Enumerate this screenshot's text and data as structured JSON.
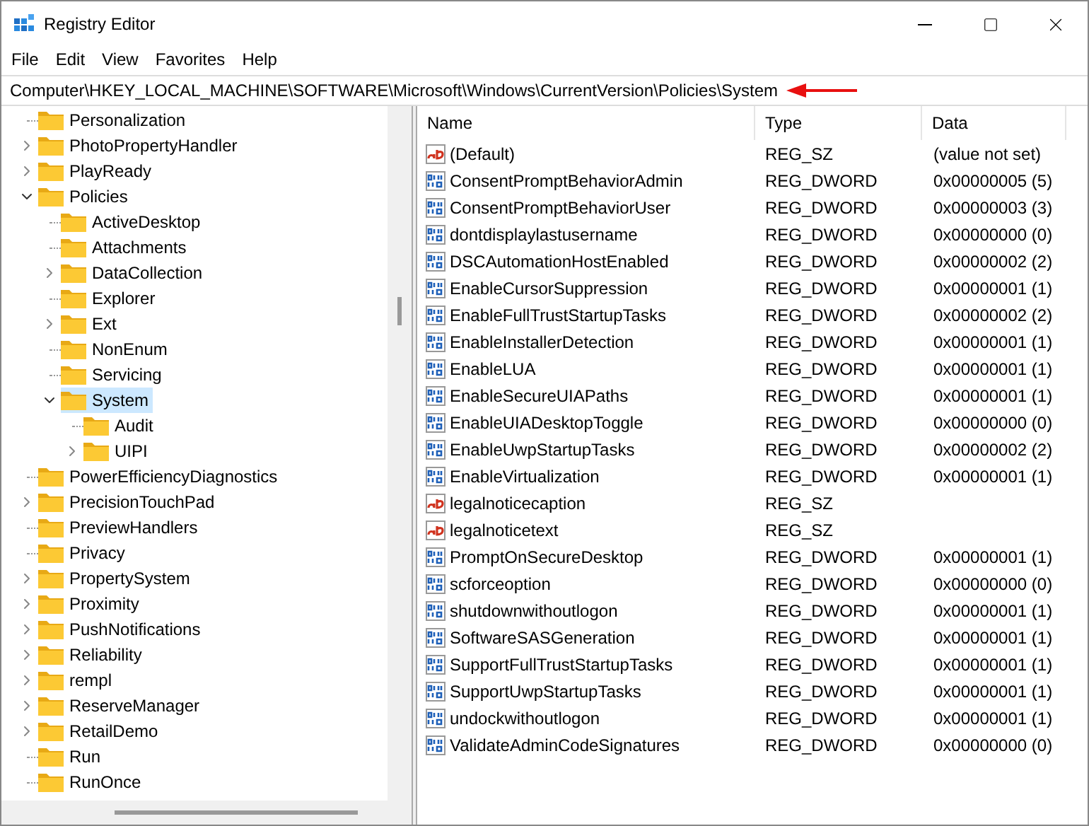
{
  "window": {
    "title": "Registry Editor"
  },
  "menu": [
    "File",
    "Edit",
    "View",
    "Favorites",
    "Help"
  ],
  "address": "Computer\\HKEY_LOCAL_MACHINE\\SOFTWARE\\Microsoft\\Windows\\CurrentVersion\\Policies\\System",
  "tree": [
    {
      "name": "Personalization",
      "expandable": false,
      "selected": false
    },
    {
      "name": "PhotoPropertyHandler",
      "expandable": true,
      "expanded": false,
      "selected": false
    },
    {
      "name": "PlayReady",
      "expandable": true,
      "expanded": false,
      "selected": false
    },
    {
      "name": "Policies",
      "expandable": true,
      "expanded": true,
      "selected": false,
      "children": [
        {
          "name": "ActiveDesktop",
          "expandable": false,
          "selected": false
        },
        {
          "name": "Attachments",
          "expandable": false,
          "selected": false
        },
        {
          "name": "DataCollection",
          "expandable": true,
          "expanded": false,
          "selected": false
        },
        {
          "name": "Explorer",
          "expandable": false,
          "selected": false
        },
        {
          "name": "Ext",
          "expandable": true,
          "expanded": false,
          "selected": false
        },
        {
          "name": "NonEnum",
          "expandable": false,
          "selected": false
        },
        {
          "name": "Servicing",
          "expandable": false,
          "selected": false
        },
        {
          "name": "System",
          "expandable": true,
          "expanded": true,
          "selected": true,
          "children": [
            {
              "name": "Audit",
              "expandable": false,
              "selected": false
            },
            {
              "name": "UIPI",
              "expandable": true,
              "expanded": false,
              "selected": false
            }
          ]
        }
      ]
    },
    {
      "name": "PowerEfficiencyDiagnostics",
      "expandable": false,
      "selected": false
    },
    {
      "name": "PrecisionTouchPad",
      "expandable": true,
      "expanded": false,
      "selected": false
    },
    {
      "name": "PreviewHandlers",
      "expandable": false,
      "selected": false
    },
    {
      "name": "Privacy",
      "expandable": false,
      "selected": false
    },
    {
      "name": "PropertySystem",
      "expandable": true,
      "expanded": false,
      "selected": false
    },
    {
      "name": "Proximity",
      "expandable": true,
      "expanded": false,
      "selected": false
    },
    {
      "name": "PushNotifications",
      "expandable": true,
      "expanded": false,
      "selected": false
    },
    {
      "name": "Reliability",
      "expandable": true,
      "expanded": false,
      "selected": false
    },
    {
      "name": "rempl",
      "expandable": true,
      "expanded": false,
      "selected": false
    },
    {
      "name": "ReserveManager",
      "expandable": true,
      "expanded": false,
      "selected": false
    },
    {
      "name": "RetailDemo",
      "expandable": true,
      "expanded": false,
      "selected": false
    },
    {
      "name": "Run",
      "expandable": false,
      "selected": false
    },
    {
      "name": "RunOnce",
      "expandable": false,
      "selected": false
    }
  ],
  "table": {
    "columns": [
      "Name",
      "Type",
      "Data"
    ],
    "rows": [
      {
        "kind": "string",
        "name": "(Default)",
        "type": "REG_SZ",
        "data": "(value not set)"
      },
      {
        "kind": "dword",
        "name": "ConsentPromptBehaviorAdmin",
        "type": "REG_DWORD",
        "data": "0x00000005 (5)"
      },
      {
        "kind": "dword",
        "name": "ConsentPromptBehaviorUser",
        "type": "REG_DWORD",
        "data": "0x00000003 (3)"
      },
      {
        "kind": "dword",
        "name": "dontdisplaylastusername",
        "type": "REG_DWORD",
        "data": "0x00000000 (0)"
      },
      {
        "kind": "dword",
        "name": "DSCAutomationHostEnabled",
        "type": "REG_DWORD",
        "data": "0x00000002 (2)"
      },
      {
        "kind": "dword",
        "name": "EnableCursorSuppression",
        "type": "REG_DWORD",
        "data": "0x00000001 (1)"
      },
      {
        "kind": "dword",
        "name": "EnableFullTrustStartupTasks",
        "type": "REG_DWORD",
        "data": "0x00000002 (2)"
      },
      {
        "kind": "dword",
        "name": "EnableInstallerDetection",
        "type": "REG_DWORD",
        "data": "0x00000001 (1)"
      },
      {
        "kind": "dword",
        "name": "EnableLUA",
        "type": "REG_DWORD",
        "data": "0x00000001 (1)"
      },
      {
        "kind": "dword",
        "name": "EnableSecureUIAPaths",
        "type": "REG_DWORD",
        "data": "0x00000001 (1)"
      },
      {
        "kind": "dword",
        "name": "EnableUIADesktopToggle",
        "type": "REG_DWORD",
        "data": "0x00000000 (0)"
      },
      {
        "kind": "dword",
        "name": "EnableUwpStartupTasks",
        "type": "REG_DWORD",
        "data": "0x00000002 (2)"
      },
      {
        "kind": "dword",
        "name": "EnableVirtualization",
        "type": "REG_DWORD",
        "data": "0x00000001 (1)"
      },
      {
        "kind": "string",
        "name": "legalnoticecaption",
        "type": "REG_SZ"
      },
      {
        "kind": "string",
        "name": "legalnoticetext",
        "type": "REG_SZ"
      },
      {
        "kind": "dword",
        "name": "PromptOnSecureDesktop",
        "type": "REG_DWORD",
        "data": "0x00000001 (1)"
      },
      {
        "kind": "dword",
        "name": "scforceoption",
        "type": "REG_DWORD",
        "data": "0x00000000 (0)"
      },
      {
        "kind": "dword",
        "name": "shutdownwithoutlogon",
        "type": "REG_DWORD",
        "data": "0x00000001 (1)"
      },
      {
        "kind": "dword",
        "name": "SoftwareSASGeneration",
        "type": "REG_DWORD",
        "data": "0x00000001 (1)"
      },
      {
        "kind": "dword",
        "name": "SupportFullTrustStartupTasks",
        "type": "REG_DWORD",
        "data": "0x00000001 (1)"
      },
      {
        "kind": "dword",
        "name": "SupportUwpStartupTasks",
        "type": "REG_DWORD",
        "data": "0x00000001 (1)"
      },
      {
        "kind": "dword",
        "name": "undockwithoutlogon",
        "type": "REG_DWORD",
        "data": "0x00000001 (1)"
      },
      {
        "kind": "dword",
        "name": "ValidateAdminCodeSignatures",
        "type": "REG_DWORD",
        "data": "0x00000000 (0)"
      }
    ]
  }
}
